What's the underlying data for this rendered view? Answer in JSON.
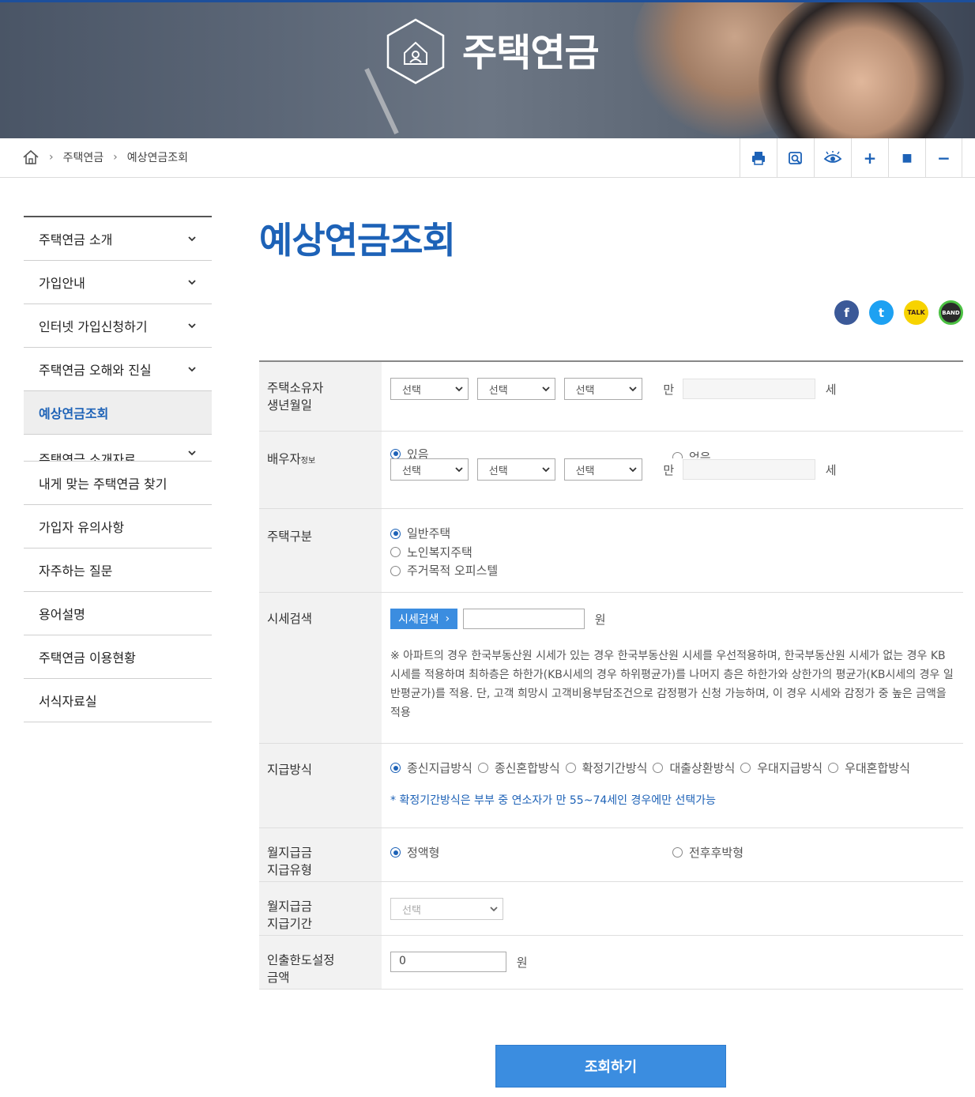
{
  "banner": {
    "title": "주택연금"
  },
  "breadcrumb": {
    "items": [
      "주택연금",
      "예상연금조회"
    ]
  },
  "tools": {
    "print_icon": "printer-icon",
    "zoom_icon": "magnify-icon",
    "view_icon": "eye-icon",
    "plus": "+",
    "reset": "■",
    "minus": "−"
  },
  "sidebar": {
    "items": [
      {
        "label": "주택연금 소개",
        "has_arrow": true
      },
      {
        "label": "가입안내",
        "has_arrow": true
      },
      {
        "label": "인터넷 가입신청하기",
        "has_arrow": true
      },
      {
        "label": "주택연금 오해와 진실",
        "has_arrow": true
      },
      {
        "label": "예상연금조회",
        "active": true
      },
      {
        "label": "주택연금 소개자료",
        "has_arrow": true
      },
      {
        "label": "내게 맞는 주택연금 찾기"
      },
      {
        "label": "가입자 유의사항"
      },
      {
        "label": "자주하는 질문"
      },
      {
        "label": "용어설명"
      },
      {
        "label": "주택연금 이용현황"
      },
      {
        "label": "서식자료실"
      }
    ]
  },
  "page": {
    "title": "예상연금조회"
  },
  "share": {
    "facebook": "f",
    "twitter": "t",
    "talk": "TALK",
    "band": "BAND"
  },
  "form": {
    "birth": {
      "label_1": "주택소유자",
      "label_2": "생년월일",
      "select_1": "선택",
      "select_2": "선택",
      "select_3": "선택",
      "age_prefix": "만",
      "age_suffix": "세"
    },
    "spouse": {
      "label": "배우자",
      "label_sub": "정보",
      "opt_yes": "있음",
      "opt_no": "없음",
      "select_1": "선택",
      "select_2": "선택",
      "select_3": "선택",
      "age_prefix": "만",
      "age_suffix": "세"
    },
    "house_type": {
      "label": "주택구분",
      "options": [
        "일반주택",
        "노인복지주택",
        "주거목적 오피스텔"
      ],
      "selected": 0
    },
    "price": {
      "label": "시세검색",
      "button": "시세검색",
      "button_arrow": "›",
      "value": "",
      "unit": "원",
      "note": "※ 아파트의 경우 한국부동산원 시세가 있는 경우 한국부동산원 시세를 우선적용하며, 한국부동산원 시세가 없는 경우 KB시세를 적용하며 최하층은 하한가(KB시세의 경우 하위평균가)를 나머지 층은 하한가와 상한가의 평균가(KB시세의 경우 일반평균가)를 적용. 단, 고객 희망시 고객비용부담조건으로 감정평가 신청 가능하며, 이 경우 시세와 감정가 중 높은 금액을 적용"
    },
    "payment": {
      "label": "지급방식",
      "options": [
        "종신지급방식",
        "종신혼합방식",
        "확정기간방식",
        "대출상환방식",
        "우대지급방식",
        "우대혼합방식"
      ],
      "selected": 0,
      "note": "* 확정기간방식은 부부 중 연소자가 만 55~74세인 경우에만 선택가능"
    },
    "monthly_type": {
      "label_1": "월지급금",
      "label_2": "지급유형",
      "opt_1": "정액형",
      "opt_2": "전후후박형",
      "selected": 0
    },
    "monthly_period": {
      "label_1": "월지급금",
      "label_2": "지급기간",
      "select": "선택"
    },
    "withdraw": {
      "label_1": "인출한도설정",
      "label_2": "금액",
      "value": "0",
      "unit": "원"
    }
  },
  "submit": {
    "label": "조회하기"
  },
  "colors": {
    "accent": "#1d62b7",
    "button": "#3b8de0"
  }
}
